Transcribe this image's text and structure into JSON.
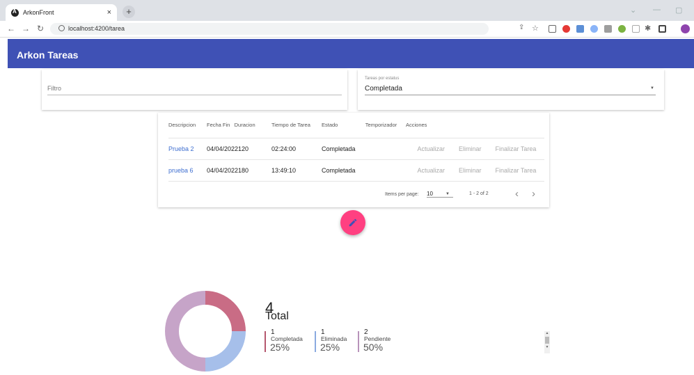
{
  "browser": {
    "tab_title": "ArkonFront",
    "tab_close": "×",
    "new_tab": "+",
    "url": "localhost:4200/tarea"
  },
  "app": {
    "title": "Arkon Tareas"
  },
  "filter": {
    "label": "Filtro"
  },
  "status_select": {
    "label": "Tareas por estatus",
    "value": "Completada"
  },
  "table": {
    "headers": [
      "Descripcion",
      "Fecha Fin",
      "Duracion",
      "Tiempo de Tarea",
      "Estado",
      "Temporizador",
      "Acciones"
    ],
    "rows": [
      {
        "descripcion": "Prueba 2",
        "fecha_duracion": "04/04/2022120",
        "tiempo": "02:24:00",
        "estado": "Completada",
        "actions": [
          "Actualizar",
          "Eliminar",
          "Finalizar Tarea"
        ]
      },
      {
        "descripcion": "prueba 6",
        "fecha_duracion": "04/04/2022180",
        "tiempo": "13:49:10",
        "estado": "Completada",
        "actions": [
          "Actualizar",
          "Eliminar",
          "Finalizar Tarea"
        ]
      }
    ]
  },
  "paginator": {
    "items_label": "Items per page:",
    "page_size": "10",
    "range": "1 - 2 of 2",
    "prev": "‹",
    "next": "›"
  },
  "summary": {
    "total_count": "4",
    "total_label": "Total",
    "items": [
      {
        "count": "1",
        "label": "Completada",
        "percent": "25%",
        "color": "#b5576e"
      },
      {
        "count": "1",
        "label": "Eliminada",
        "percent": "25%",
        "color": "#8aaae0"
      },
      {
        "count": "2",
        "label": "Pendiente",
        "percent": "50%",
        "color": "#b893ba"
      }
    ]
  },
  "chart_data": {
    "type": "pie",
    "categories": [
      "Completada",
      "Eliminada",
      "Pendiente"
    ],
    "values": [
      1,
      1,
      2
    ],
    "colors": [
      "#c96c85",
      "#a6bfea",
      "#c6a4c8"
    ]
  },
  "colors": {
    "primary": "#3f51b5",
    "accent": "#ff4081"
  }
}
